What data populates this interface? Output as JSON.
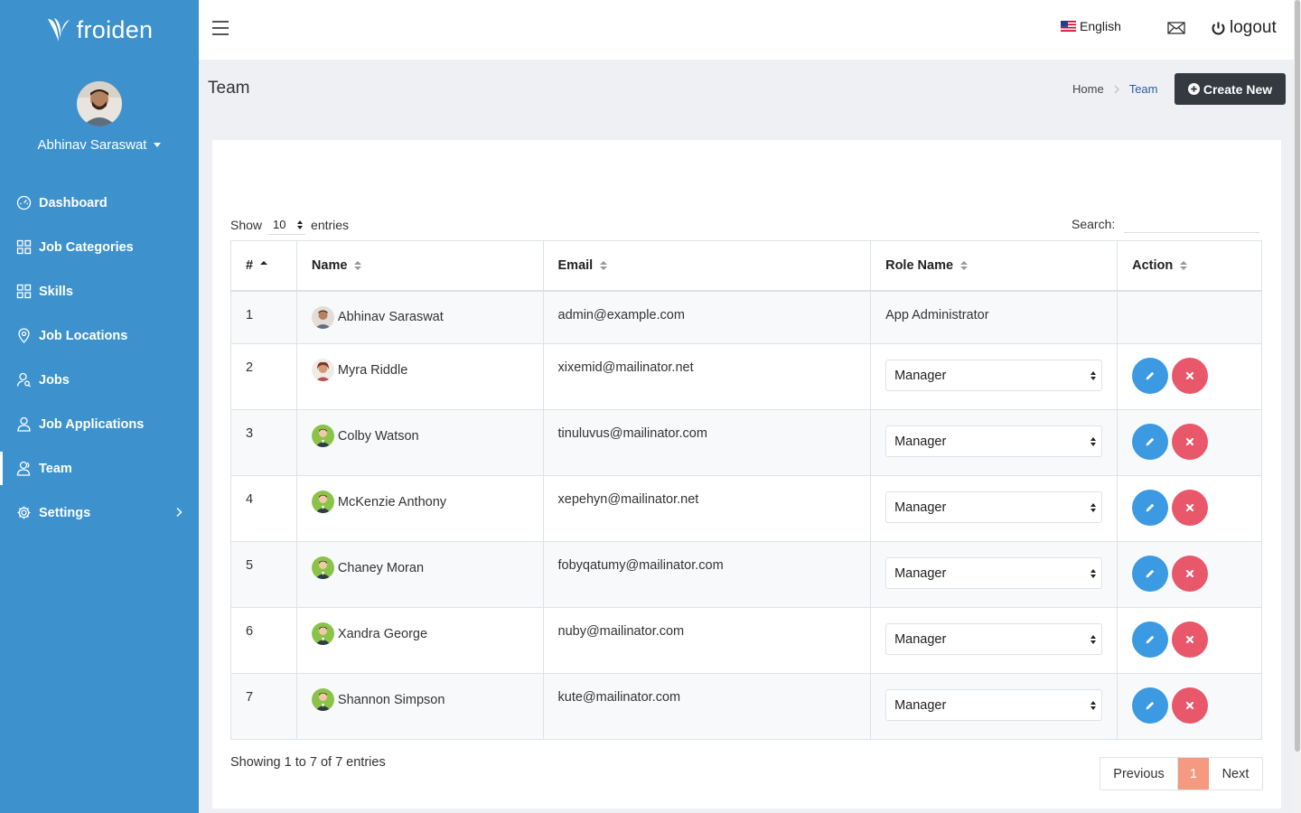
{
  "brand": {
    "name": "froiden"
  },
  "user": {
    "name": "Abhinav Saraswat"
  },
  "sidebar": {
    "items": [
      {
        "label": "Dashboard",
        "icon": "dashboard-gauge-icon"
      },
      {
        "label": "Job Categories",
        "icon": "grid-icon"
      },
      {
        "label": "Skills",
        "icon": "grid-icon"
      },
      {
        "label": "Job Locations",
        "icon": "map-pin-icon"
      },
      {
        "label": "Jobs",
        "icon": "user-search-icon"
      },
      {
        "label": "Job Applications",
        "icon": "user-icon"
      },
      {
        "label": "Team",
        "icon": "user-team-icon",
        "active": true
      },
      {
        "label": "Settings",
        "icon": "gear-icon",
        "has_submenu": true
      }
    ]
  },
  "topbar": {
    "language": "English",
    "logout_label": "logout"
  },
  "page": {
    "title": "Team",
    "breadcrumb": [
      "Home",
      "Team"
    ],
    "create_button": "Create New"
  },
  "table_controls": {
    "show_label": "Show",
    "entries_value": "10",
    "entries_label": "entries",
    "search_label": "Search:",
    "search_value": ""
  },
  "table": {
    "headers": [
      "#",
      "Name",
      "Email",
      "Role Name",
      "Action"
    ],
    "rows": [
      {
        "id": "1",
        "name": "Abhinav Saraswat",
        "email": "admin@example.com",
        "role": "App Administrator",
        "editable": false
      },
      {
        "id": "2",
        "name": "Myra Riddle",
        "email": "xixemid@mailinator.net",
        "role": "Manager",
        "editable": true
      },
      {
        "id": "3",
        "name": "Colby Watson",
        "email": "tinuluvus@mailinator.com",
        "role": "Manager",
        "editable": true
      },
      {
        "id": "4",
        "name": "McKenzie Anthony",
        "email": "xepehyn@mailinator.net",
        "role": "Manager",
        "editable": true
      },
      {
        "id": "5",
        "name": "Chaney Moran",
        "email": "fobyqatumy@mailinator.com",
        "role": "Manager",
        "editable": true
      },
      {
        "id": "6",
        "name": "Xandra George",
        "email": "nuby@mailinator.com",
        "role": "Manager",
        "editable": true
      },
      {
        "id": "7",
        "name": "Shannon Simpson",
        "email": "kute@mailinator.com",
        "role": "Manager",
        "editable": true
      }
    ]
  },
  "footer": {
    "showing": "Showing 1 to 7 of 7 entries",
    "prev": "Previous",
    "page": "1",
    "next": "Next"
  },
  "colors": {
    "sidebar": "#3d92ce",
    "dark_button": "#343a40",
    "edit": "#3b9ae1",
    "delete": "#e8576a",
    "active_page": "#f39a80"
  }
}
